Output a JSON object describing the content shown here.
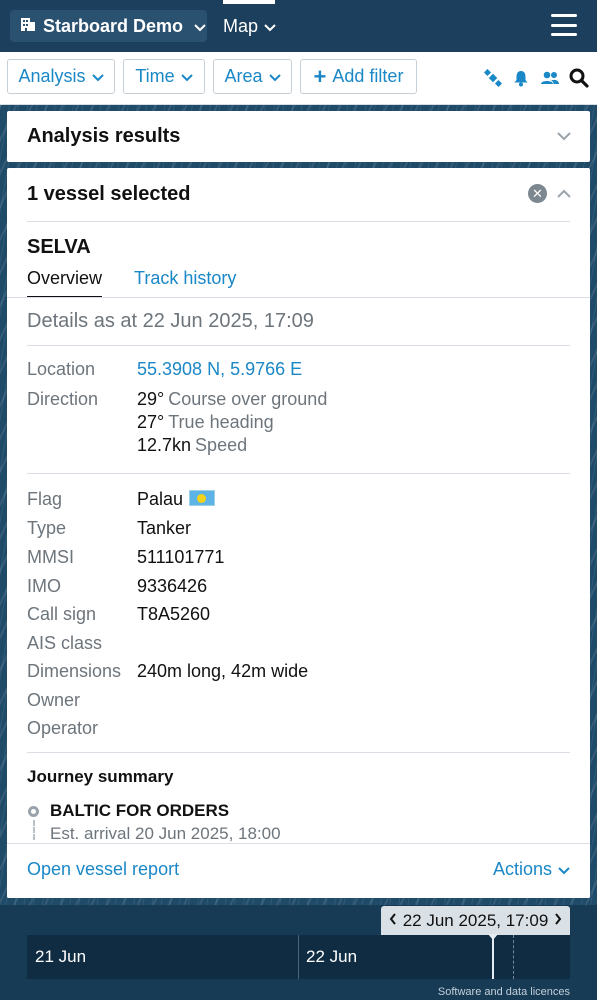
{
  "topnav": {
    "org_name": "Starboard Demo",
    "map_label": "Map"
  },
  "filterbar": {
    "analysis_label": "Analysis",
    "time_label": "Time",
    "area_label": "Area",
    "add_filter_label": "Add filter"
  },
  "results_panel": {
    "title": "Analysis results"
  },
  "vessel_panel": {
    "header": "1 vessel selected",
    "vessel_name": "SELVA",
    "tabs": [
      {
        "label": "Overview",
        "active": true
      },
      {
        "label": "Track history",
        "active": false
      }
    ],
    "details_at": "Details as at 22 Jun 2025, 17:09",
    "location": {
      "label": "Location",
      "value": "55.3908 N, 5.9766 E"
    },
    "direction": {
      "label": "Direction",
      "course_value": "29°",
      "course_label": "Course over ground",
      "heading_value": "27°",
      "heading_label": "True heading",
      "speed_value": "12.7kn",
      "speed_label": "Speed"
    },
    "fields": {
      "flag": {
        "label": "Flag",
        "value": "Palau"
      },
      "type": {
        "label": "Type",
        "value": "Tanker"
      },
      "mmsi": {
        "label": "MMSI",
        "value": "511101771"
      },
      "imo": {
        "label": "IMO",
        "value": "9336426"
      },
      "call_sign": {
        "label": "Call sign",
        "value": "T8A5260"
      },
      "ais_class": {
        "label": "AIS class",
        "value": ""
      },
      "dimensions": {
        "label": "Dimensions",
        "value": "240m long, 42m wide"
      },
      "owner": {
        "label": "Owner",
        "value": ""
      },
      "operator": {
        "label": "Operator",
        "value": ""
      }
    },
    "journey": {
      "title": "Journey summary",
      "destination": "BALTIC FOR ORDERS",
      "eta": "Est. arrival 20 Jun 2025, 18:00"
    },
    "footer": {
      "open_report": "Open vessel report",
      "actions": "Actions"
    }
  },
  "timeline": {
    "current_time": "22 Jun 2025, 17:09",
    "days": [
      "21 Jun",
      "22 Jun"
    ],
    "licences": "Software and data licences"
  },
  "colors": {
    "nav_bg": "#1b3f5c",
    "link_blue": "#1a87c7",
    "muted_text": "#6d757c",
    "map_bg": "#1f4a68"
  }
}
